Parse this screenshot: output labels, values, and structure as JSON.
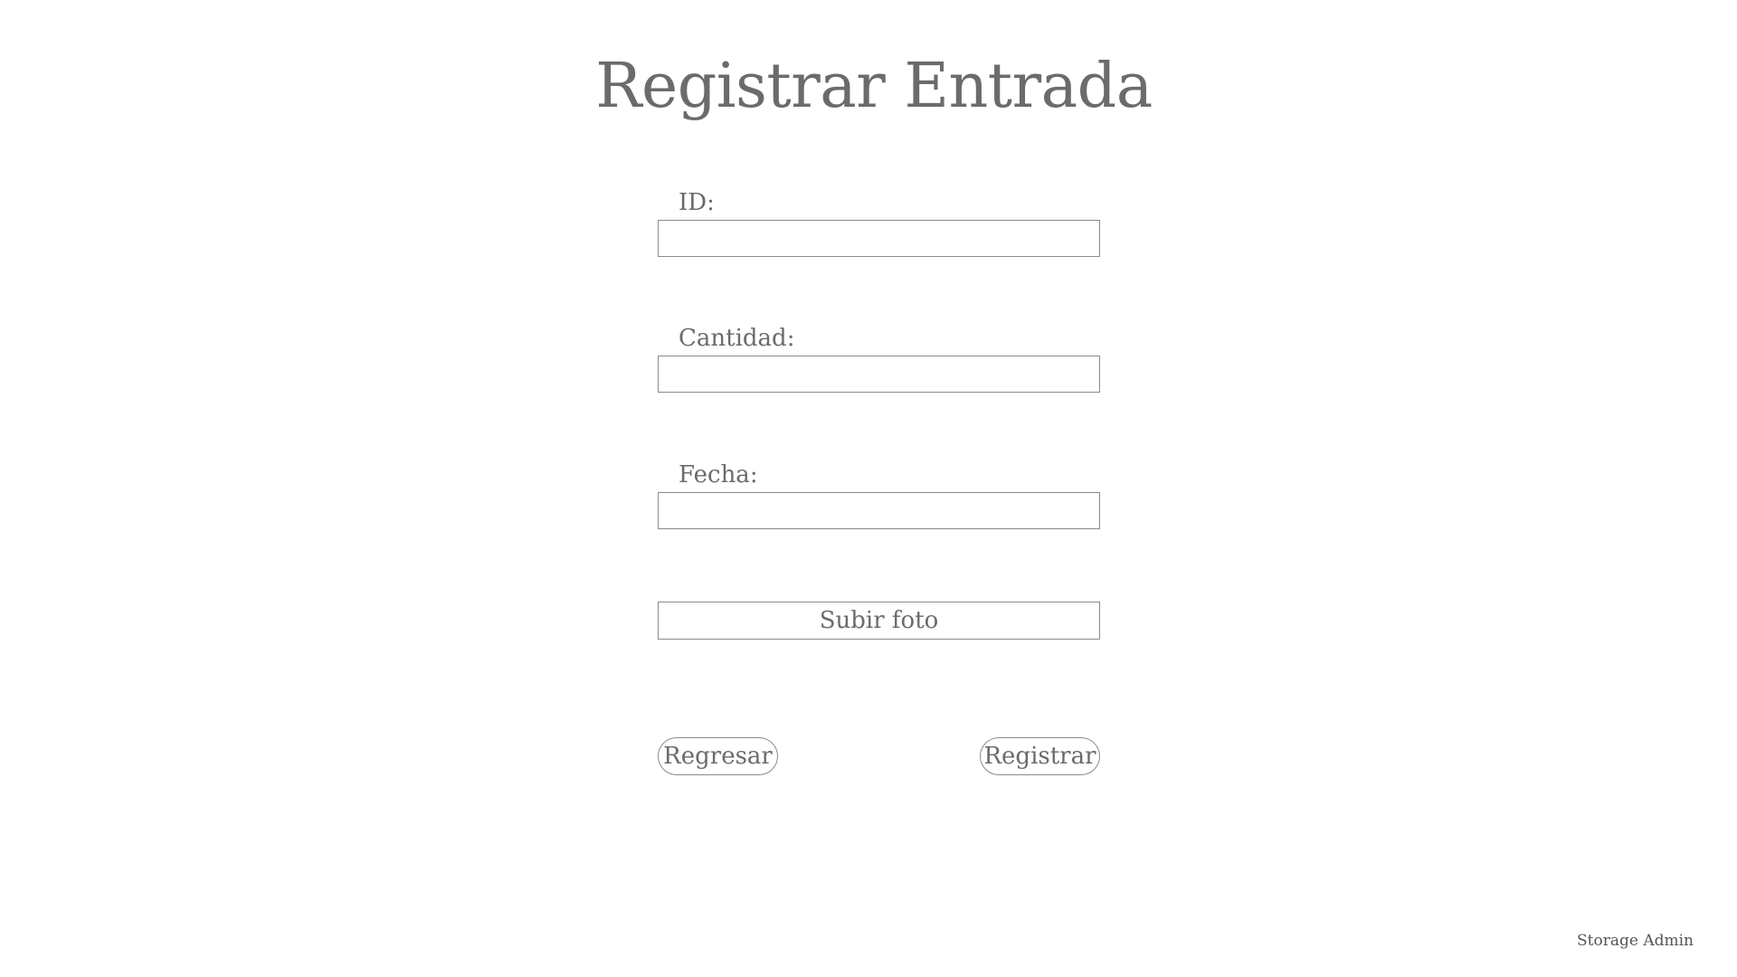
{
  "page": {
    "title": "Registrar Entrada"
  },
  "form": {
    "id_label": "ID:",
    "id_value": "",
    "cantidad_label": "Cantidad:",
    "cantidad_value": "",
    "fecha_label": "Fecha:",
    "fecha_value": "",
    "upload_label": "Subir foto",
    "back_label": "Regresar",
    "submit_label": "Registrar"
  },
  "footer": {
    "brand": "Storage Admin"
  },
  "colors": {
    "text": "#6b6b6b",
    "border": "#8a8a8a",
    "background": "#ffffff"
  }
}
